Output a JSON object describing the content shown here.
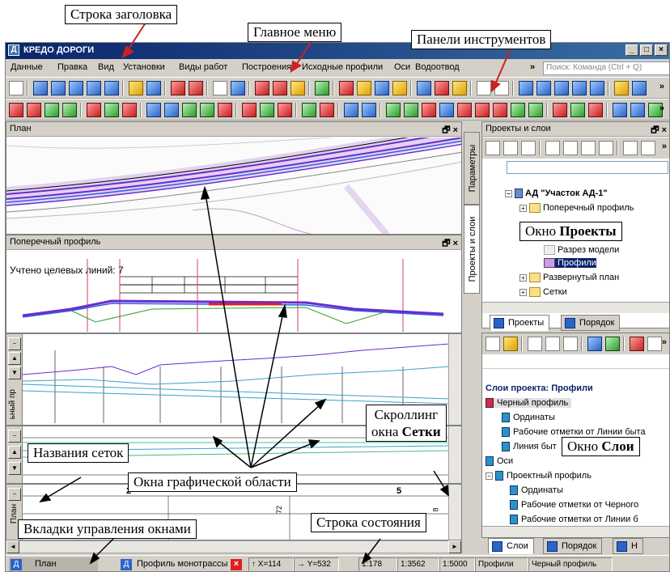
{
  "callouts": {
    "title_bar": "Строка заголовка",
    "main_menu": "Главное меню",
    "toolbars": "Панели инструментов",
    "projects_window_prefix": "Окно ",
    "projects_window_bold": "Проекты",
    "layers_window_prefix": "Окно ",
    "layers_window_bold": "Слои",
    "grid_scroll_line1": "Скроллинг",
    "grid_scroll_line2_prefix": "окна ",
    "grid_scroll_line2_bold": "Сетки",
    "grid_names": "Названия сеток",
    "graphic_windows": "Окна графической области",
    "window_tabs": "Вкладки управления окнами",
    "status_bar": "Строка состояния"
  },
  "app": {
    "title": "КРЕДО ДОРОГИ",
    "icon_letter": "Д",
    "min": "_",
    "max": "□",
    "close": "×"
  },
  "menu": {
    "items": [
      "Данные",
      "Правка",
      "Вид",
      "Установки",
      "Виды работ",
      "Построения",
      "Исходные профили",
      "Оси",
      "Водоотвод"
    ],
    "more": "»",
    "search_placeholder": "Поиск: Команда (Ctrl + Q)"
  },
  "toolbars": {
    "more": "»"
  },
  "plan": {
    "title": "План",
    "buttons": "🗗 ×"
  },
  "cross": {
    "title": "Поперечный профиль",
    "buttons": "🗗 ×",
    "counted": "Учтено целевых линий: 7"
  },
  "profile": {
    "side_label": "ьный пр"
  },
  "grids": {
    "label_plan": "План",
    "n2": "2",
    "n5": "5",
    "n72": "72",
    "n8": "8"
  },
  "side_tabs": {
    "params": "Параметры",
    "projects_layers": "Проекты и слои"
  },
  "projects": {
    "title": "Проекты и слои",
    "buttons": "🗗 ×",
    "tree": [
      {
        "label": "АД \"Участок АД-1\"",
        "sign": "−"
      },
      {
        "label": "Поперечный профиль",
        "sign": "+"
      },
      {
        "label": "Разрез модели",
        "sign": ""
      },
      {
        "label": "Профили",
        "sign": ""
      },
      {
        "label": "Развернутый план",
        "sign": "+"
      },
      {
        "label": "Сетки",
        "sign": "+"
      }
    ],
    "tab_projects": "Проекты",
    "tab_order": "Порядок"
  },
  "layers": {
    "heading": "Слои проекта: Профили",
    "tree": [
      "Черный профиль",
      "Ординаты",
      "Рабочие отметки от Линии быта",
      "Линия быт",
      "Оси",
      "Проектный профиль",
      "Ординаты",
      "Рабочие отметки от Черного",
      "Рабочие отметки от Линии б"
    ],
    "tab_layers": "Слои",
    "tab_order": "Порядок",
    "tab_third": "Н"
  },
  "status": {
    "tab_plan": "План",
    "tab_profile": "Профиль монотрассы",
    "x": "↑ X=114",
    "y": "→ Y=532",
    "s1": "1:178",
    "s2": "1:3562",
    "s3": "1:5000",
    "s4": "Профили",
    "s5": "Черный профиль"
  },
  "colors": {
    "title_bar": "#0a246a",
    "accent_red": "#cc2222",
    "road_purple": "#6a2bd0"
  }
}
